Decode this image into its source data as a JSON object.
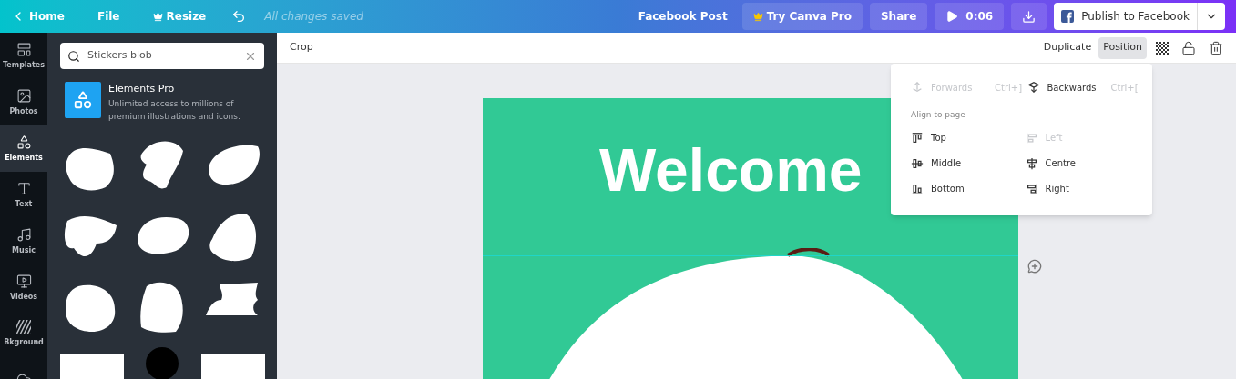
{
  "topbar": {
    "home": "Home",
    "file": "File",
    "resize": "Resize",
    "save_status": "All changes saved",
    "doc_title": "Facebook Post",
    "pro": "Try Canva Pro",
    "share": "Share",
    "duration": "0:06",
    "publish": "Publish to Facebook"
  },
  "rail": [
    {
      "kind": "templates",
      "label": "Templates",
      "selected": false
    },
    {
      "kind": "photos",
      "label": "Photos",
      "selected": false
    },
    {
      "kind": "elements",
      "label": "Elements",
      "selected": true
    },
    {
      "kind": "text",
      "label": "Text",
      "selected": false
    },
    {
      "kind": "music",
      "label": "Music",
      "selected": false
    },
    {
      "kind": "videos",
      "label": "Videos",
      "selected": false
    },
    {
      "kind": "background",
      "label": "Bkground",
      "selected": false
    },
    {
      "kind": "upload",
      "selected": false
    }
  ],
  "panel": {
    "search": "Stickers blob",
    "promo_title": "Elements Pro",
    "promo_text": "Unlimited access to millions of premium illustrations and icons."
  },
  "toolbar": {
    "crop": "Crop",
    "duplicate": "Duplicate",
    "position": "Position",
    "position_open": true
  },
  "menu": {
    "layer": [
      {
        "kind": "forward",
        "label": "Forwards",
        "shortcut": "Ctrl+]",
        "disabled": true
      },
      {
        "kind": "backward",
        "label": "Backwards",
        "shortcut": "Ctrl+[",
        "disabled": false
      }
    ],
    "section": "Align to page",
    "align": [
      {
        "kind": "top",
        "label": "Top",
        "disabled": false
      },
      {
        "kind": "left",
        "label": "Left",
        "disabled": true
      },
      {
        "kind": "middle",
        "label": "Middle",
        "disabled": false
      },
      {
        "kind": "centre",
        "label": "Centre",
        "disabled": false
      },
      {
        "kind": "bottom",
        "label": "Bottom",
        "disabled": false
      },
      {
        "kind": "right",
        "label": "Right",
        "disabled": false
      }
    ]
  },
  "design": {
    "heading": "Welcome"
  }
}
